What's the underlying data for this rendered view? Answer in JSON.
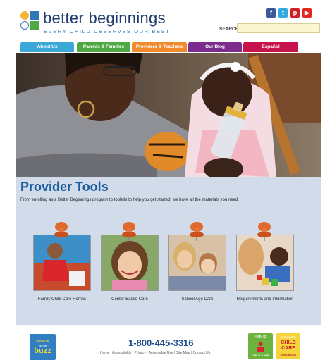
{
  "header": {
    "logo_name": "better beginnings",
    "logo_tagline": "EVERY CHILD DESERVES OUR BEST",
    "search_label": "SEARCH",
    "search_placeholder": "",
    "social": [
      {
        "name": "facebook-icon",
        "glyph": "f",
        "color": "#3b5998"
      },
      {
        "name": "twitter-icon",
        "glyph": "t",
        "color": "#33a9e0"
      },
      {
        "name": "pinterest-icon",
        "glyph": "p",
        "color": "#cb2027"
      },
      {
        "name": "youtube-icon",
        "glyph": "▶",
        "color": "#e02a20"
      }
    ]
  },
  "nav": {
    "tabs": [
      {
        "label": "About Us",
        "color": "#3ca8d8"
      },
      {
        "label": "Parents & Families",
        "color": "#4ea844"
      },
      {
        "label": "Providers & Teachers",
        "color": "#f08a2c"
      },
      {
        "label": "Our Blog",
        "color": "#7b2d8e"
      },
      {
        "label": "Español",
        "color": "#c8124b"
      }
    ]
  },
  "main": {
    "title": "Provider Tools",
    "intro": "From enrolling as a Better Beginnings program to toolkits to help you get started, we have all the materials you need.",
    "tiles": [
      {
        "caption": "Family Child Care Homes"
      },
      {
        "caption": "Center-Based Care"
      },
      {
        "caption": "School Age Care"
      },
      {
        "caption": "Requirements and Information"
      }
    ]
  },
  "footer": {
    "buzz_line1": "SIGN UP",
    "buzz_line2": "for the",
    "buzz_line3": "buzz",
    "phone": "1-800-445-3316",
    "links": "Home | Accessibility | Privacy | Acceptable Use | Site Map | Contact Us",
    "find_line1": "FIND",
    "find_line2": "CHILD CARE",
    "choose_line1": "CHOOSING",
    "choose_line2": "CHILD",
    "choose_line3": "CARE",
    "choose_line4": "CHECKLIST"
  },
  "colors": {
    "brand_blue": "#1c5d9c",
    "panel_bg": "#d1dbea",
    "search_bg": "#fbf6cf"
  }
}
